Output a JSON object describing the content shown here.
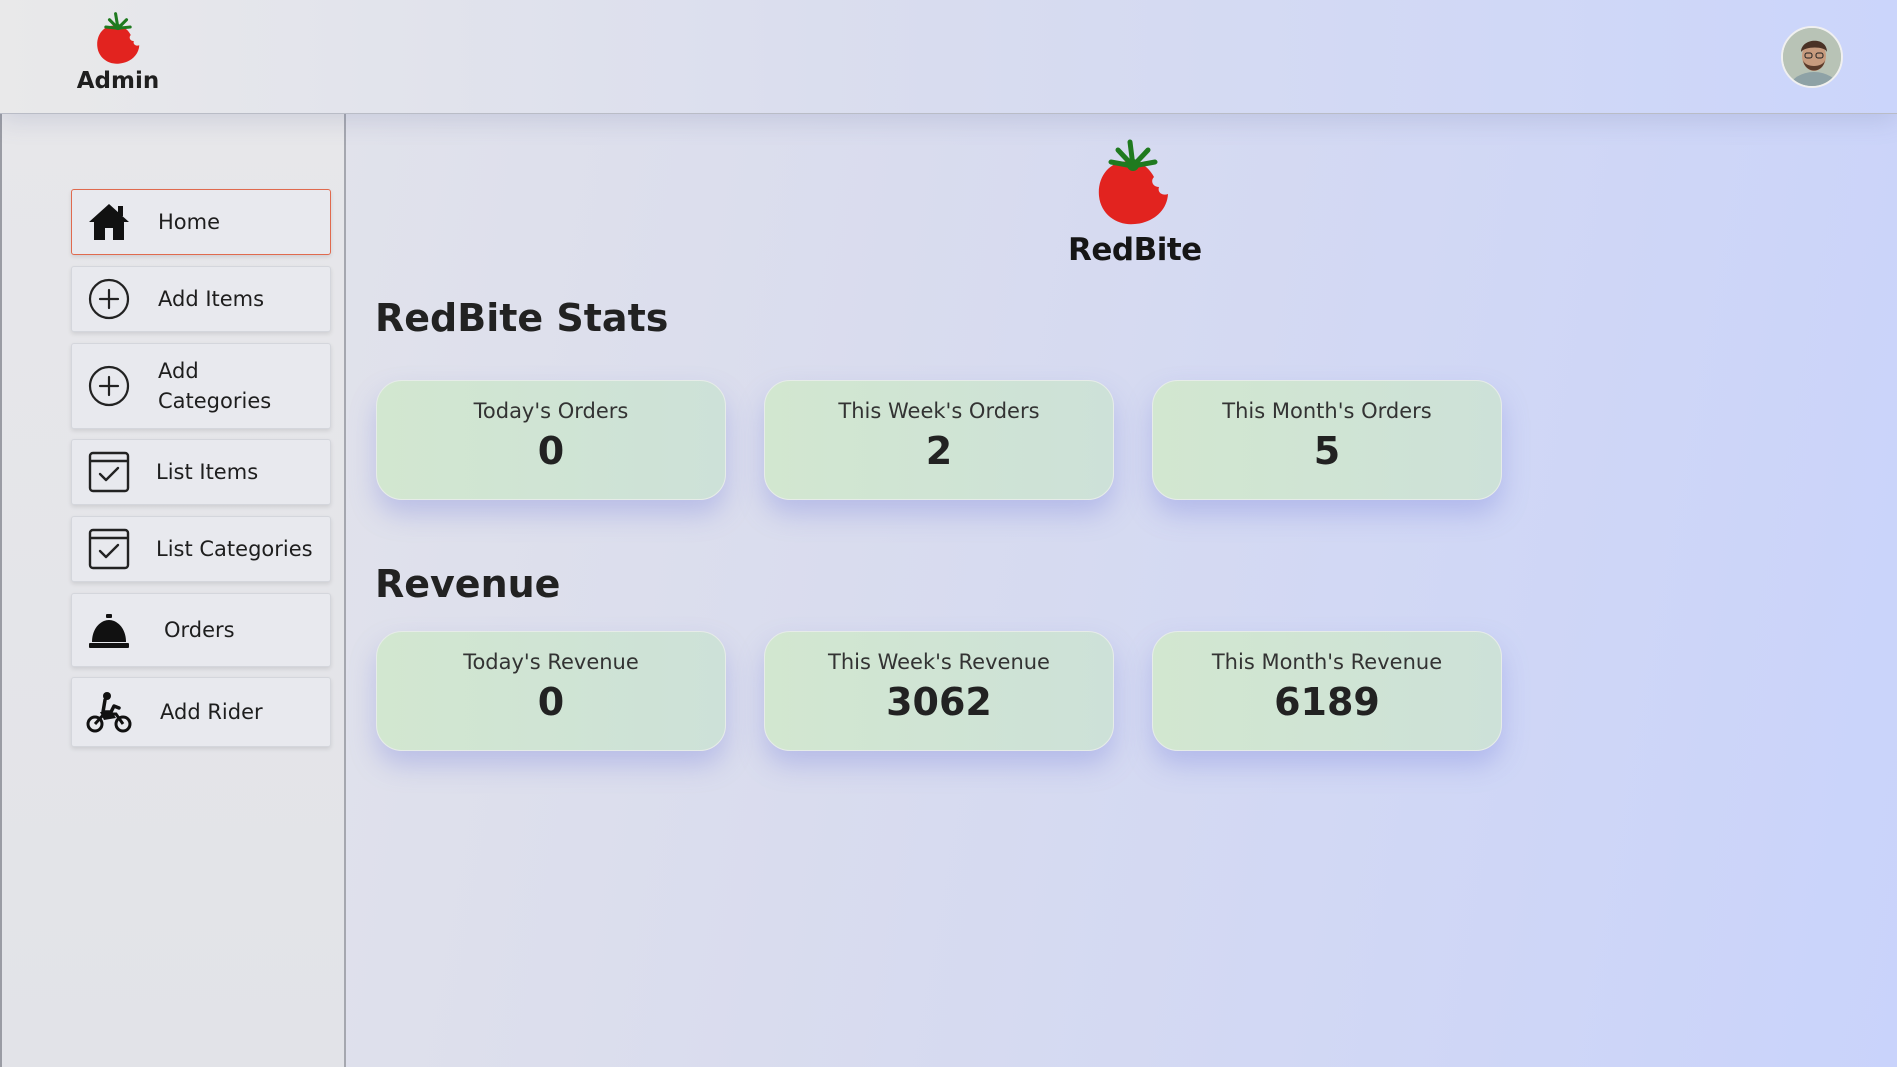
{
  "header": {
    "admin_label": "Admin"
  },
  "sidebar": {
    "items": [
      {
        "label": "Home",
        "icon": "home-icon"
      },
      {
        "label": "Add Items",
        "icon": "add-circle-icon"
      },
      {
        "label": "Add Categories",
        "icon": "add-circle-icon"
      },
      {
        "label": "List Items",
        "icon": "calendar-check-icon"
      },
      {
        "label": "List Categories",
        "icon": "calendar-check-icon"
      },
      {
        "label": "Orders",
        "icon": "service-bell-icon"
      },
      {
        "label": "Add Rider",
        "icon": "motorcycle-rider-icon"
      }
    ]
  },
  "main": {
    "brand_name": "RedBite",
    "stats_title": "RedBite Stats",
    "stats": [
      {
        "label": "Today's Orders",
        "value": "0"
      },
      {
        "label": "This Week's Orders",
        "value": "2"
      },
      {
        "label": "This Month's Orders",
        "value": "5"
      }
    ],
    "revenue_title": "Revenue",
    "revenue": [
      {
        "label": "Today's Revenue",
        "value": "0"
      },
      {
        "label": "This Week's Revenue",
        "value": "3062"
      },
      {
        "label": "This Month's Revenue",
        "value": "6189"
      }
    ]
  },
  "colors": {
    "tomato": "#e2231f",
    "leaf": "#1f7a1f",
    "active_border": "#e06a4e",
    "card_bg": "#d2e7d0"
  }
}
